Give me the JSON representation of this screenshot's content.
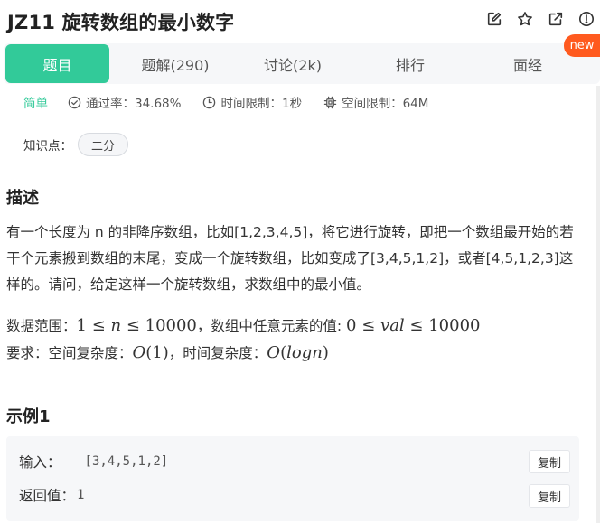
{
  "problem": {
    "title": "JZ11  旋转数组的最小数字"
  },
  "header_icons": [
    "edit-icon",
    "star-icon",
    "external-link-icon",
    "info-icon"
  ],
  "tabs": [
    {
      "label": "题目",
      "active": true
    },
    {
      "label": "题解(290)",
      "active": false
    },
    {
      "label": "讨论(2k)",
      "active": false
    },
    {
      "label": "排行",
      "active": false
    },
    {
      "label": "面经",
      "active": false
    }
  ],
  "badge": {
    "new_label": "new"
  },
  "meta": {
    "difficulty": "简单",
    "pass_rate": "通过率：34.68%",
    "time_limit": "时间限制：1秒",
    "space_limit": "空间限制：64M"
  },
  "knowledge": {
    "label": "知识点：",
    "tags": [
      "二分"
    ]
  },
  "description": {
    "heading": "描述",
    "text": "有一个长度为 n 的非降序数组，比如[1,2,3,4,5]，将它进行旋转，即把一个数组最开始的若干个元素搬到数组的末尾，变成一个旋转数组，比如变成了[3,4,5,1,2]，或者[4,5,1,2,3]这样的。请问，给定这样一个旋转数组，求数组中的最小值。"
  },
  "limits": {
    "range_prefix": "数据范围：",
    "range_math_1": "1 ≤ ",
    "range_var_n": "n",
    "range_math_2": " ≤ 10000",
    "range_mid": "，数组中任意元素的值: ",
    "range_math_3": "0 ≤ ",
    "range_var_val": "val",
    "range_math_4": " ≤ 10000",
    "req_prefix": "要求：空间复杂度：",
    "space_o": "O",
    "space_arg": "(1)",
    "req_mid": "，时间复杂度：",
    "time_o": "O",
    "time_open": "(",
    "time_var": "logn",
    "time_close": ")"
  },
  "example": {
    "heading": "示例1",
    "input_label": "输入：",
    "input_value": "[3,4,5,1,2]",
    "output_label": "返回值：",
    "output_value": "1",
    "copy_label": "复制"
  },
  "colors": {
    "accent": "#32ca99",
    "badge": "#ff5a1f",
    "tab_bar_bg": "#f6f7f9"
  }
}
